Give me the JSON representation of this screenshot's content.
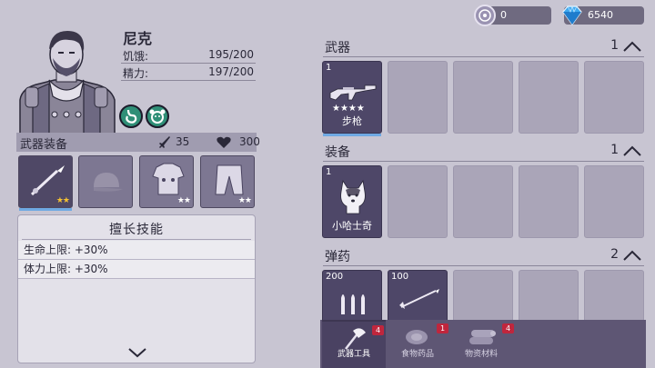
{
  "currencies": [
    {
      "icon": "coin-icon",
      "value": "0"
    },
    {
      "icon": "diamond-icon",
      "value": "6540"
    }
  ],
  "character": {
    "name": "尼克",
    "stats": [
      {
        "label": "饥饿:",
        "value": "195/200"
      },
      {
        "label": "精力:",
        "value": "197/200"
      }
    ]
  },
  "equipment": {
    "title": "武器装备",
    "attack": "35",
    "health": "300",
    "slots": [
      {
        "icon": "spear-icon",
        "stars": "★★",
        "star_color": "gold",
        "active": true
      },
      {
        "icon": "cap-icon",
        "stars": "",
        "star_color": "white",
        "active": false
      },
      {
        "icon": "armor-icon",
        "stars": "★★",
        "star_color": "white",
        "active": false
      },
      {
        "icon": "pants-icon",
        "stars": "★★",
        "star_color": "white",
        "active": false
      }
    ]
  },
  "skills": {
    "title": "擅长技能",
    "lines": [
      "生命上限: +30%",
      "体力上限: +30%"
    ]
  },
  "inventory": {
    "sections": [
      {
        "title": "武器",
        "count": "1",
        "items": [
          {
            "qty": "1",
            "name": "步枪",
            "stars": "★★★★",
            "icon": "rifle-icon"
          }
        ]
      },
      {
        "title": "装备",
        "count": "1",
        "items": [
          {
            "qty": "1",
            "name": "小哈士奇",
            "icon": "husky-icon"
          }
        ]
      },
      {
        "title": "弹药",
        "count": "2",
        "items": [
          {
            "qty": "200",
            "icon": "bullets-icon"
          },
          {
            "qty": "100",
            "icon": "arrow-icon"
          }
        ]
      }
    ]
  },
  "tabs": [
    {
      "label": "武器工具",
      "badge": "4",
      "icon": "axe-icon"
    },
    {
      "label": "食物药品",
      "badge": "1",
      "icon": "meat-icon"
    },
    {
      "label": "物资材料",
      "badge": "4",
      "icon": "logs-icon"
    }
  ]
}
